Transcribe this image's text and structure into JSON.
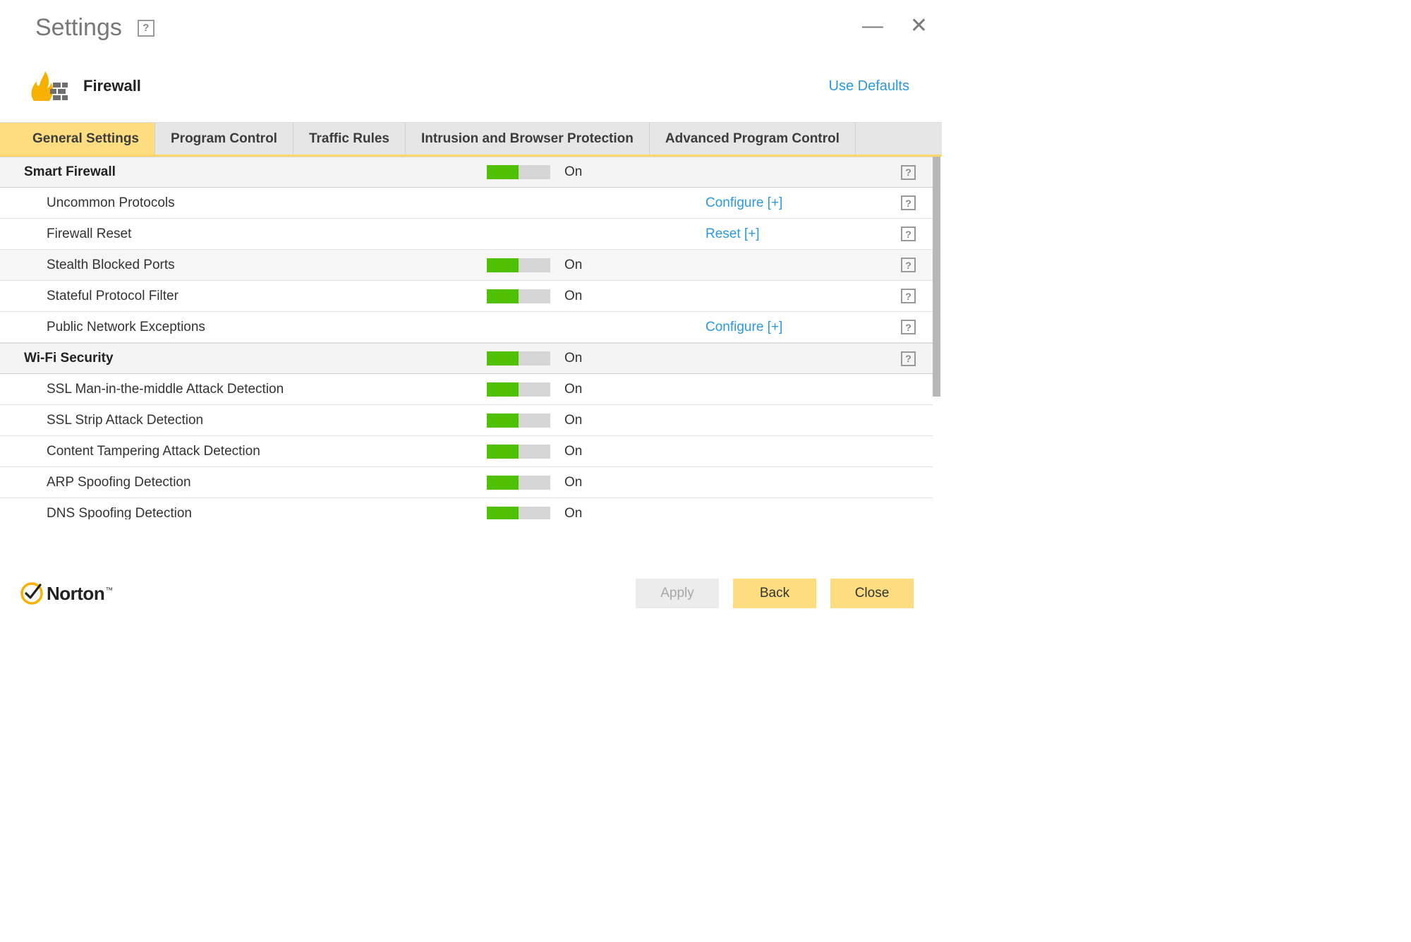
{
  "window": {
    "title": "Settings"
  },
  "section": {
    "title": "Firewall",
    "use_defaults": "Use Defaults"
  },
  "tabs": [
    {
      "label": "General Settings",
      "active": true
    },
    {
      "label": "Program Control",
      "active": false
    },
    {
      "label": "Traffic Rules",
      "active": false
    },
    {
      "label": "Intrusion and Browser Protection",
      "active": false
    },
    {
      "label": "Advanced Program Control",
      "active": false
    }
  ],
  "rows": [
    {
      "type": "group",
      "label": "Smart Firewall",
      "toggle": true,
      "status": "On",
      "help": true
    },
    {
      "type": "item",
      "label": "Uncommon Protocols",
      "action": "Configure [+]",
      "help": true
    },
    {
      "type": "item",
      "label": "Firewall Reset",
      "action": "Reset [+]",
      "help": true
    },
    {
      "type": "item",
      "label": "Stealth Blocked Ports",
      "toggle": true,
      "status": "On",
      "help": true,
      "alt": true
    },
    {
      "type": "item",
      "label": "Stateful Protocol Filter",
      "toggle": true,
      "status": "On",
      "help": true
    },
    {
      "type": "item",
      "label": "Public Network Exceptions",
      "action": "Configure [+]",
      "help": true
    },
    {
      "type": "group",
      "label": "Wi-Fi Security",
      "toggle": true,
      "status": "On",
      "help": true
    },
    {
      "type": "item",
      "label": "SSL Man-in-the-middle Attack Detection",
      "toggle": true,
      "status": "On"
    },
    {
      "type": "item",
      "label": "SSL Strip Attack Detection",
      "toggle": true,
      "status": "On"
    },
    {
      "type": "item",
      "label": "Content Tampering Attack Detection",
      "toggle": true,
      "status": "On"
    },
    {
      "type": "item",
      "label": "ARP Spoofing Detection",
      "toggle": true,
      "status": "On"
    },
    {
      "type": "item",
      "label": "DNS Spoofing Detection",
      "toggle": true,
      "status": "On"
    }
  ],
  "footer": {
    "brand": "Norton",
    "apply": "Apply",
    "back": "Back",
    "close": "Close"
  },
  "colors": {
    "accent_yellow": "#fedd81",
    "toggle_green": "#4fc100",
    "link_blue": "#2a99e0"
  }
}
